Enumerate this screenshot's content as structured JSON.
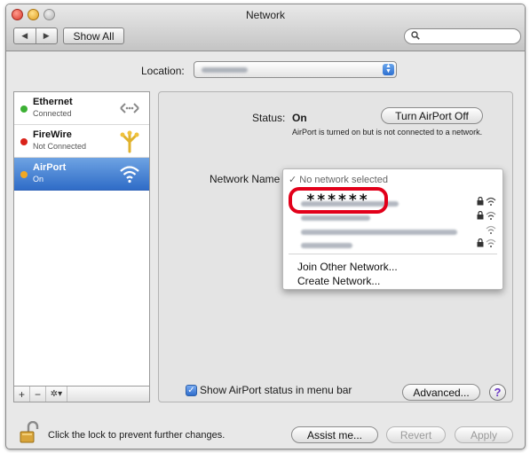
{
  "window": {
    "title": "Network",
    "show_all": "Show All",
    "nav_back": "◀",
    "nav_forward": "▶"
  },
  "search": {
    "placeholder": "",
    "icon": "search-icon"
  },
  "location": {
    "label": "Location:"
  },
  "services": [
    {
      "name": "Ethernet",
      "status": "Connected",
      "dot_color": "#3cb034",
      "icon": "ethernet-arrows-icon"
    },
    {
      "name": "FireWire",
      "status": "Not Connected",
      "dot_color": "#d9231a",
      "icon": "firewire-icon"
    },
    {
      "name": "AirPort",
      "status": "On",
      "dot_color": "#f0a824",
      "icon": "wifi-icon",
      "selected": true
    }
  ],
  "sidebar_tools": {
    "add": "+",
    "remove": "−",
    "gear": "✲▾"
  },
  "status": {
    "label": "Status:",
    "value": "On",
    "toggle_button": "Turn AirPort Off",
    "note": "AirPort is turned on but is not connected to a network."
  },
  "network_name": {
    "label": "Network Name",
    "selected": "✓ No network selected",
    "highlighted_network": "******",
    "networks": [
      {
        "locked": true
      },
      {
        "locked": true
      },
      {
        "locked": false
      },
      {
        "locked": true
      }
    ],
    "join_other": "Join Other Network...",
    "create": "Create Network..."
  },
  "options": {
    "show_status_checked": true,
    "checkmark": "✓",
    "show_status_label": "Show AirPort status in menu bar",
    "advanced": "Advanced...",
    "help": "?"
  },
  "footer": {
    "lock_text": "Click the lock to prevent further changes.",
    "assist": "Assist me...",
    "revert": "Revert",
    "apply": "Apply"
  },
  "colors": {
    "selection": "#3a76cf",
    "highlight_ring": "#e2001a"
  }
}
